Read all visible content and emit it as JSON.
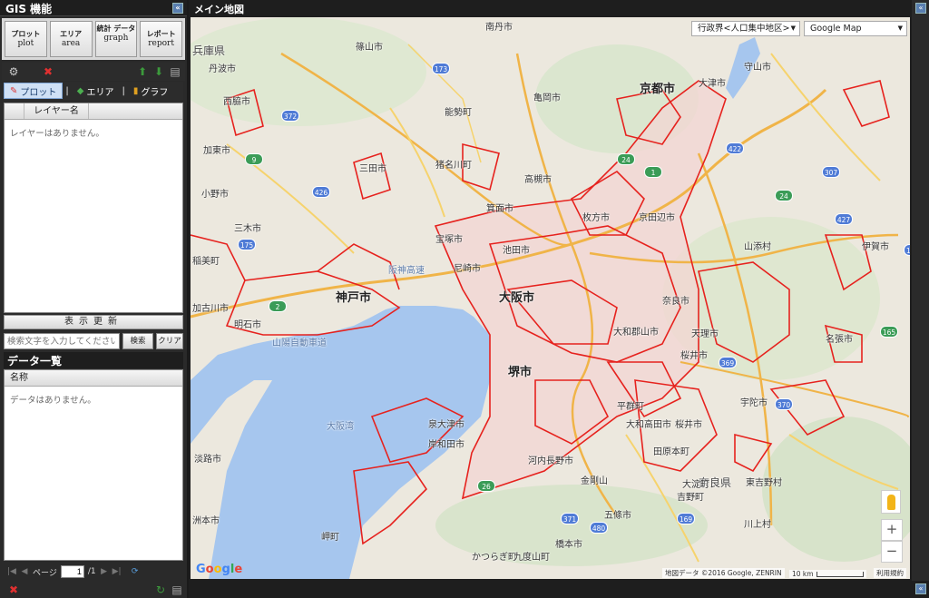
{
  "left_panel": {
    "title": "GIS 機能",
    "functions": [
      {
        "jp": "プロット",
        "en": "plot"
      },
      {
        "jp": "エリア",
        "en": "area"
      },
      {
        "jp": "統計 データ",
        "en": "graph"
      },
      {
        "jp": "レポート",
        "en": "report"
      }
    ],
    "tabs": [
      "プロット",
      "エリア",
      "グラフ"
    ],
    "layer_column": "レイヤー名",
    "layer_empty": "レイヤーはありません。",
    "refresh_label": "表示更新",
    "search_placeholder": "検索文字を入力してください",
    "search_button": "検索",
    "clear_button": "クリア",
    "data_title": "データ一覧",
    "data_column": "名称",
    "data_empty": "データはありません。",
    "pager": {
      "page_label": "ページ",
      "page_value": "1",
      "page_total": "/1"
    }
  },
  "map_panel": {
    "title": "メイン地図",
    "boundary_select": "行政界<人口集中地区>",
    "basemap_select": "Google Map",
    "google_logo": "Google",
    "attribution": "地図データ ©2016 Google, ZENRIN",
    "scale": "10 km",
    "terms": "利用規約",
    "zoom_in": "+",
    "zoom_out": "−",
    "place_labels": {
      "hyogo": "兵庫県",
      "tamba": "丹波市",
      "sasayama": "篠山市",
      "nantan": "南丹市",
      "kyoto": "京都市",
      "otsu": "大津市",
      "moriyama": "守山市",
      "nishiwaki": "西脇市",
      "kasai": "加東市",
      "sanda": "三田市",
      "ono": "小野市",
      "miki": "三木市",
      "inami": "稲美町",
      "kobe": "神戸市",
      "osaka": "大阪市",
      "takatsuki": "高槻市",
      "hirakata": "枚方市",
      "kyotanabe": "京田辺市",
      "nara": "奈良市",
      "sakai": "堺市",
      "kishiwada": "岸和田市",
      "izumisano": "泉大津市",
      "awaji": "淡路市",
      "nara_pref": "奈良県",
      "gojo": "五條市",
      "iga": "伊賀市",
      "osaka_bay": "大阪湾",
      "uji": "宇陀市",
      "kashihara": "桜井市",
      "yamatokoriyama": "大和郡山市",
      "tenri": "天理市",
      "sumoto": "洲本市",
      "hashimoto": "橋本市",
      "amagasaki": "尼崎市",
      "minoh": "箕面市",
      "ikeda": "池田市",
      "takarazuka": "宝塚市",
      "katsuragi": "かつらぎ町",
      "kudoyama": "九度山町",
      "misaki": "岬町",
      "kawachinagano": "河内長野市",
      "yoshino": "吉野町",
      "kongo": "金剛山",
      "higashiyoshino": "東吉野村",
      "kawakami": "川上村",
      "oyodo": "大淀町",
      "yamazoe": "山添村",
      "nabari": "名張市",
      "sakurai": "桜井市",
      "heguri": "平群町",
      "takada": "大和高田市",
      "tawaramoto": "田原本町",
      "nose": "能勢町",
      "inagawa": "猪名川町",
      "kameoka": "亀岡市",
      "akashi": "明石市",
      "kako": "加古川市",
      "sanyo_exp": "山陽自動車道",
      "hanshin_exp": "阪神高速"
    },
    "routes": [
      "372",
      "173",
      "426",
      "175",
      "422",
      "163",
      "307",
      "369",
      "427",
      "24",
      "370",
      "371",
      "480",
      "169",
      "24",
      "26",
      "1",
      "2",
      "9",
      "165"
    ]
  }
}
